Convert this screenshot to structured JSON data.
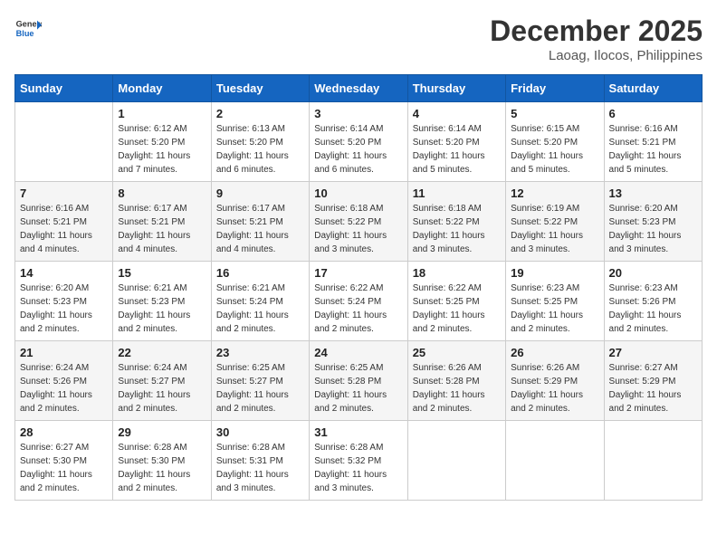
{
  "header": {
    "logo_line1": "General",
    "logo_line2": "Blue",
    "month": "December 2025",
    "location": "Laoag, Ilocos, Philippines"
  },
  "weekdays": [
    "Sunday",
    "Monday",
    "Tuesday",
    "Wednesday",
    "Thursday",
    "Friday",
    "Saturday"
  ],
  "weeks": [
    [
      {
        "day": "",
        "sunrise": "",
        "sunset": "",
        "daylight": ""
      },
      {
        "day": "1",
        "sunrise": "6:12 AM",
        "sunset": "5:20 PM",
        "daylight": "11 hours and 7 minutes."
      },
      {
        "day": "2",
        "sunrise": "6:13 AM",
        "sunset": "5:20 PM",
        "daylight": "11 hours and 6 minutes."
      },
      {
        "day": "3",
        "sunrise": "6:14 AM",
        "sunset": "5:20 PM",
        "daylight": "11 hours and 6 minutes."
      },
      {
        "day": "4",
        "sunrise": "6:14 AM",
        "sunset": "5:20 PM",
        "daylight": "11 hours and 5 minutes."
      },
      {
        "day": "5",
        "sunrise": "6:15 AM",
        "sunset": "5:20 PM",
        "daylight": "11 hours and 5 minutes."
      },
      {
        "day": "6",
        "sunrise": "6:16 AM",
        "sunset": "5:21 PM",
        "daylight": "11 hours and 5 minutes."
      }
    ],
    [
      {
        "day": "7",
        "sunrise": "6:16 AM",
        "sunset": "5:21 PM",
        "daylight": "11 hours and 4 minutes."
      },
      {
        "day": "8",
        "sunrise": "6:17 AM",
        "sunset": "5:21 PM",
        "daylight": "11 hours and 4 minutes."
      },
      {
        "day": "9",
        "sunrise": "6:17 AM",
        "sunset": "5:21 PM",
        "daylight": "11 hours and 4 minutes."
      },
      {
        "day": "10",
        "sunrise": "6:18 AM",
        "sunset": "5:22 PM",
        "daylight": "11 hours and 3 minutes."
      },
      {
        "day": "11",
        "sunrise": "6:18 AM",
        "sunset": "5:22 PM",
        "daylight": "11 hours and 3 minutes."
      },
      {
        "day": "12",
        "sunrise": "6:19 AM",
        "sunset": "5:22 PM",
        "daylight": "11 hours and 3 minutes."
      },
      {
        "day": "13",
        "sunrise": "6:20 AM",
        "sunset": "5:23 PM",
        "daylight": "11 hours and 3 minutes."
      }
    ],
    [
      {
        "day": "14",
        "sunrise": "6:20 AM",
        "sunset": "5:23 PM",
        "daylight": "11 hours and 2 minutes."
      },
      {
        "day": "15",
        "sunrise": "6:21 AM",
        "sunset": "5:23 PM",
        "daylight": "11 hours and 2 minutes."
      },
      {
        "day": "16",
        "sunrise": "6:21 AM",
        "sunset": "5:24 PM",
        "daylight": "11 hours and 2 minutes."
      },
      {
        "day": "17",
        "sunrise": "6:22 AM",
        "sunset": "5:24 PM",
        "daylight": "11 hours and 2 minutes."
      },
      {
        "day": "18",
        "sunrise": "6:22 AM",
        "sunset": "5:25 PM",
        "daylight": "11 hours and 2 minutes."
      },
      {
        "day": "19",
        "sunrise": "6:23 AM",
        "sunset": "5:25 PM",
        "daylight": "11 hours and 2 minutes."
      },
      {
        "day": "20",
        "sunrise": "6:23 AM",
        "sunset": "5:26 PM",
        "daylight": "11 hours and 2 minutes."
      }
    ],
    [
      {
        "day": "21",
        "sunrise": "6:24 AM",
        "sunset": "5:26 PM",
        "daylight": "11 hours and 2 minutes."
      },
      {
        "day": "22",
        "sunrise": "6:24 AM",
        "sunset": "5:27 PM",
        "daylight": "11 hours and 2 minutes."
      },
      {
        "day": "23",
        "sunrise": "6:25 AM",
        "sunset": "5:27 PM",
        "daylight": "11 hours and 2 minutes."
      },
      {
        "day": "24",
        "sunrise": "6:25 AM",
        "sunset": "5:28 PM",
        "daylight": "11 hours and 2 minutes."
      },
      {
        "day": "25",
        "sunrise": "6:26 AM",
        "sunset": "5:28 PM",
        "daylight": "11 hours and 2 minutes."
      },
      {
        "day": "26",
        "sunrise": "6:26 AM",
        "sunset": "5:29 PM",
        "daylight": "11 hours and 2 minutes."
      },
      {
        "day": "27",
        "sunrise": "6:27 AM",
        "sunset": "5:29 PM",
        "daylight": "11 hours and 2 minutes."
      }
    ],
    [
      {
        "day": "28",
        "sunrise": "6:27 AM",
        "sunset": "5:30 PM",
        "daylight": "11 hours and 2 minutes."
      },
      {
        "day": "29",
        "sunrise": "6:28 AM",
        "sunset": "5:30 PM",
        "daylight": "11 hours and 2 minutes."
      },
      {
        "day": "30",
        "sunrise": "6:28 AM",
        "sunset": "5:31 PM",
        "daylight": "11 hours and 3 minutes."
      },
      {
        "day": "31",
        "sunrise": "6:28 AM",
        "sunset": "5:32 PM",
        "daylight": "11 hours and 3 minutes."
      },
      {
        "day": "",
        "sunrise": "",
        "sunset": "",
        "daylight": ""
      },
      {
        "day": "",
        "sunrise": "",
        "sunset": "",
        "daylight": ""
      },
      {
        "day": "",
        "sunrise": "",
        "sunset": "",
        "daylight": ""
      }
    ]
  ]
}
